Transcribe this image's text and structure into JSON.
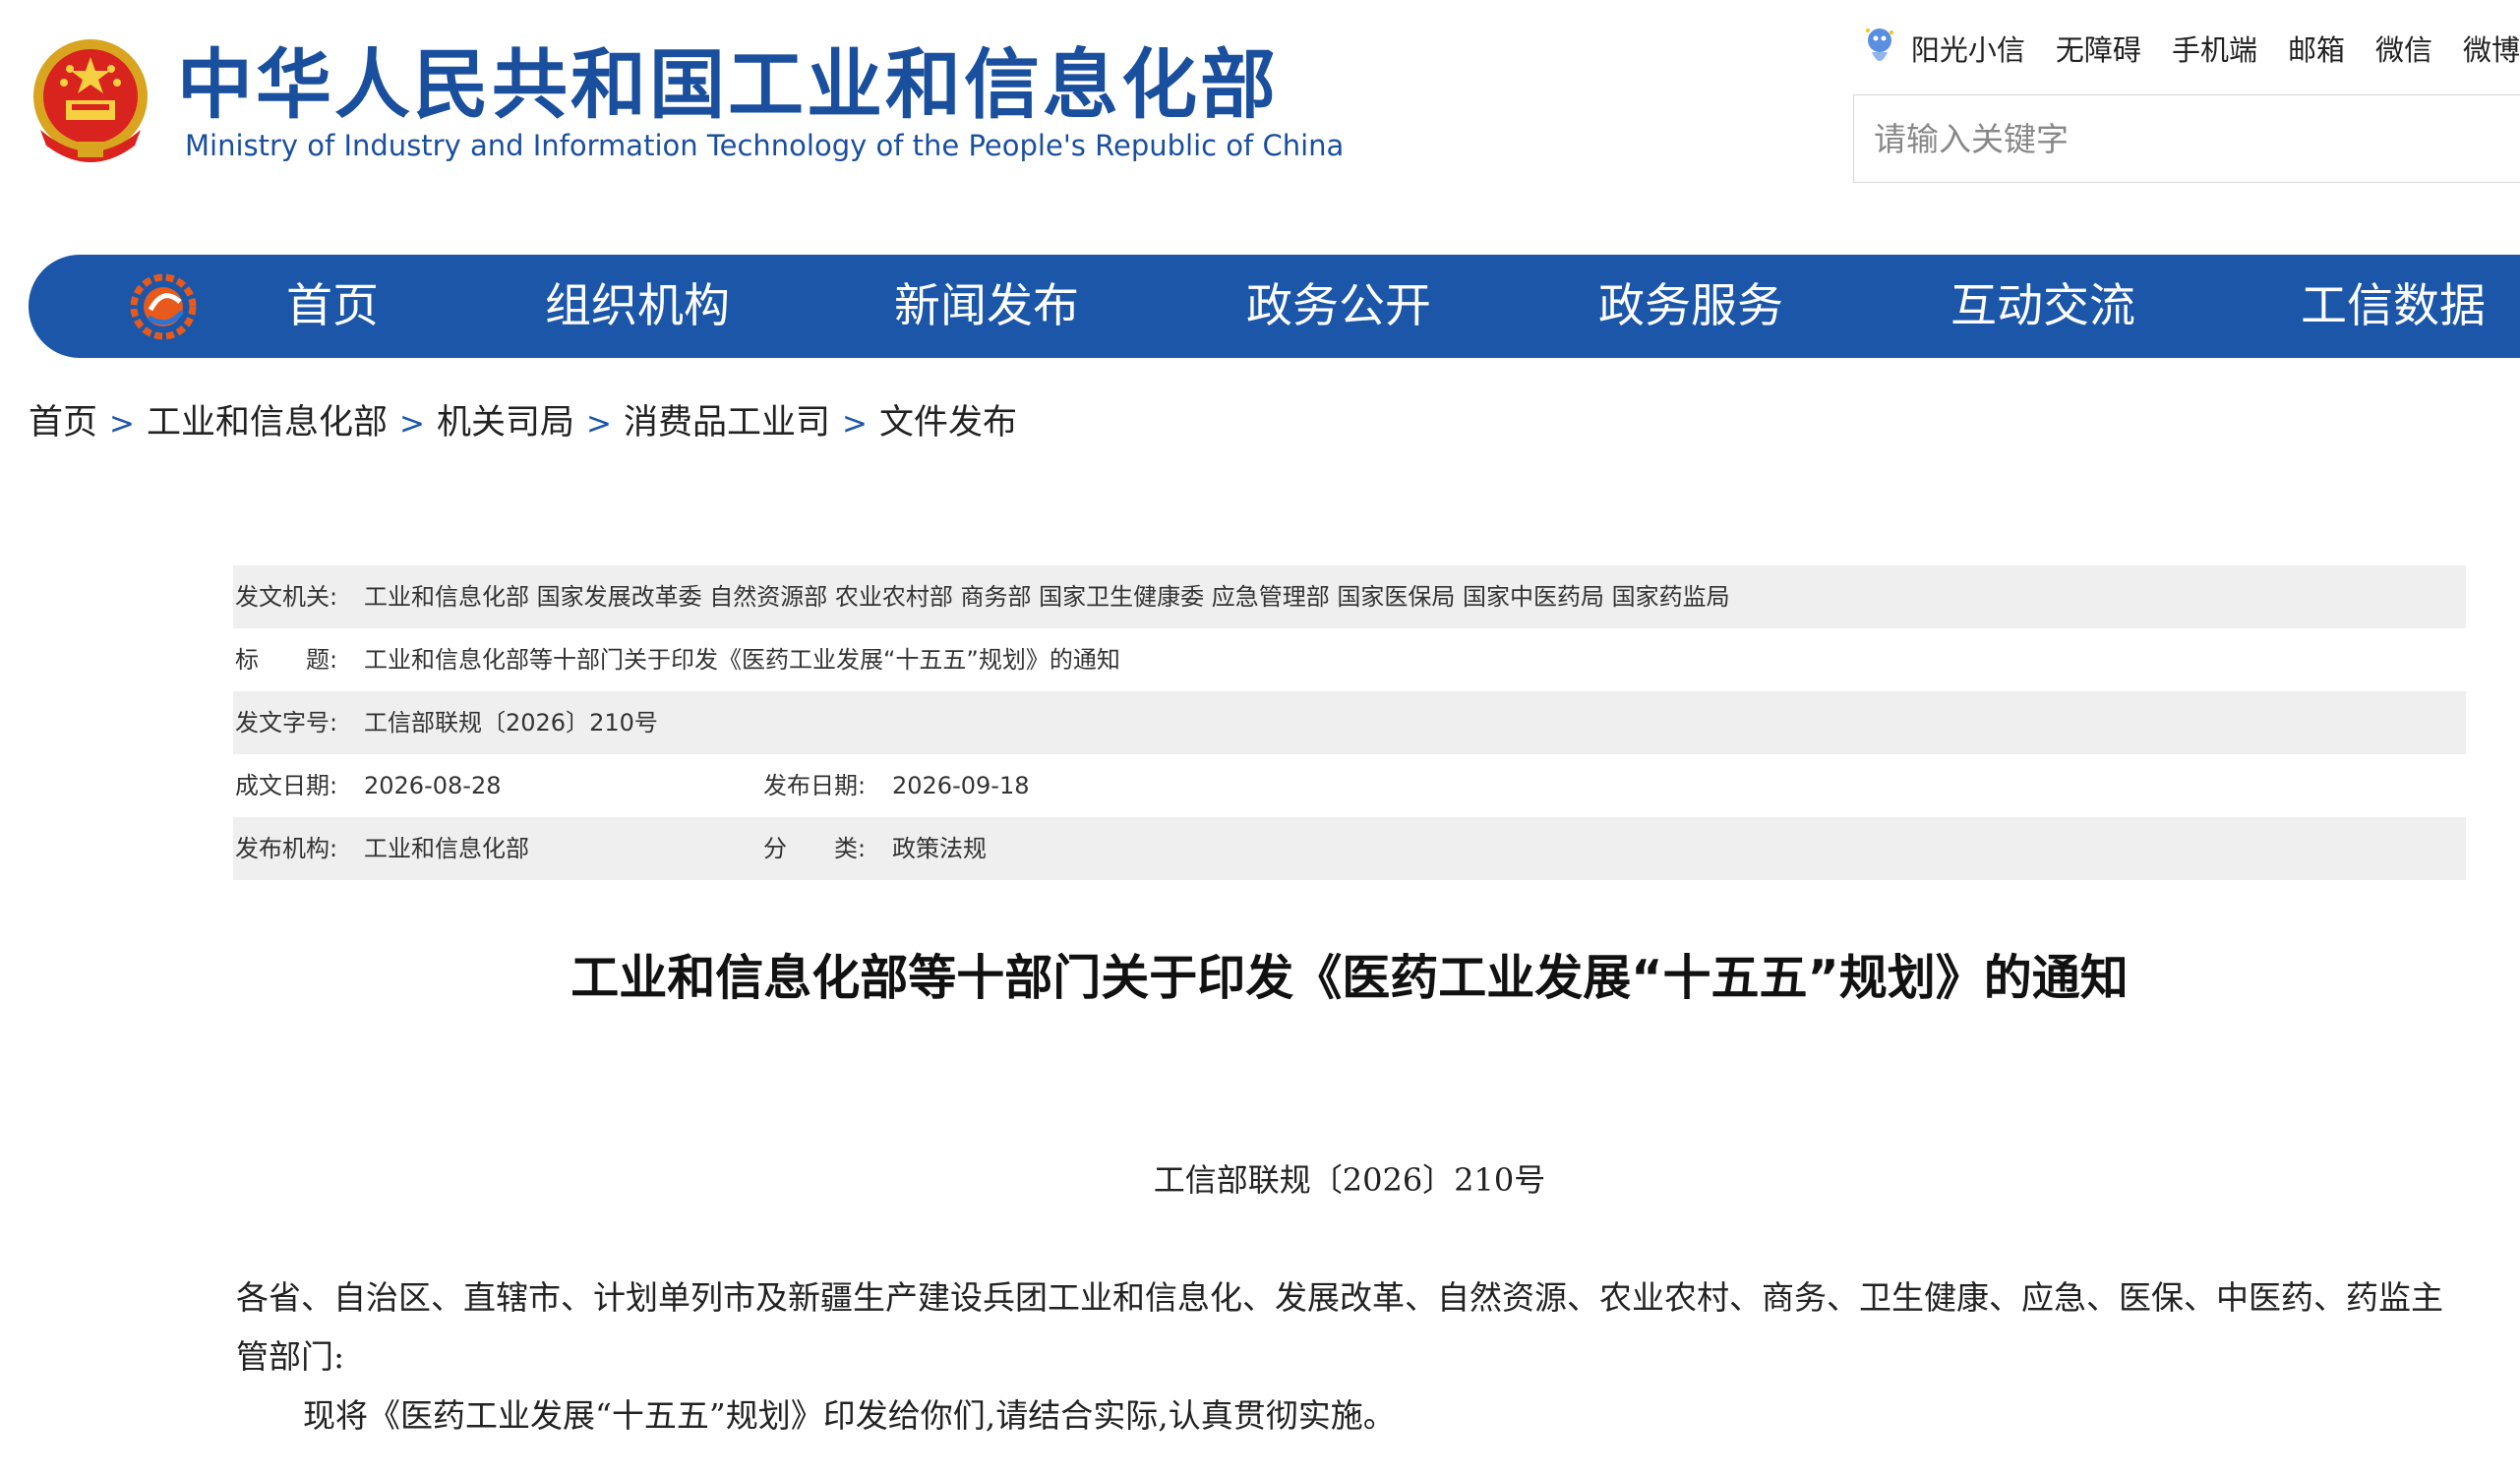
{
  "header": {
    "title_cn": "中华人民共和国工业和信息化部",
    "title_en": "Ministry of Industry and Information Technology of the People's Republic of China",
    "top_links": [
      "阳光小信",
      "无障碍",
      "手机端",
      "邮箱",
      "微信",
      "微博"
    ],
    "search_placeholder": "请输入关键字"
  },
  "nav": {
    "items": [
      "首页",
      "组织机构",
      "新闻发布",
      "政务公开",
      "政务服务",
      "互动交流",
      "工信数据"
    ]
  },
  "breadcrumb": {
    "items": [
      "首页",
      "工业和信息化部",
      "机关司局",
      "消费品工业司",
      "文件发布"
    ],
    "separator": ">"
  },
  "meta": {
    "issuer_label": "发文机关:",
    "issuer": "工业和信息化部 国家发展改革委 自然资源部 农业农村部 商务部 国家卫生健康委 应急管理部 国家医保局 国家中医药局 国家药监局",
    "subject_label": "标　　题:",
    "subject": "工业和信息化部等十部门关于印发《医药工业发展“十五五”规划》的通知",
    "doc_no_label": "发文字号:",
    "doc_no": "工信部联规〔2026〕210号",
    "created_label": "成文日期:",
    "created": "2026-08-28",
    "published_label": "发布日期:",
    "published": "2026-09-18",
    "publisher_label": "发布机构:",
    "publisher": "工业和信息化部",
    "category_label": "分　　类:",
    "category": "政策法规"
  },
  "article": {
    "title": "工业和信息化部等十部门关于印发《医药工业发展“十五五”规划》的通知",
    "doc_number": "工信部联规〔2026〕210号",
    "salutation": "各省、自治区、直辖市、计划单列市及新疆生产建设兵团工业和信息化、发展改革、自然资源、农业农村、商务、卫生健康、应急、医保、中医药、药监主管部门:",
    "paragraph1": "现将《医药工业发展“十五五”规划》印发给你们,请结合实际,认真贯彻实施。"
  },
  "colors": {
    "brand_blue": "#1b56a8",
    "title_blue": "#1a4f9e",
    "meta_shade": "#efefef"
  }
}
